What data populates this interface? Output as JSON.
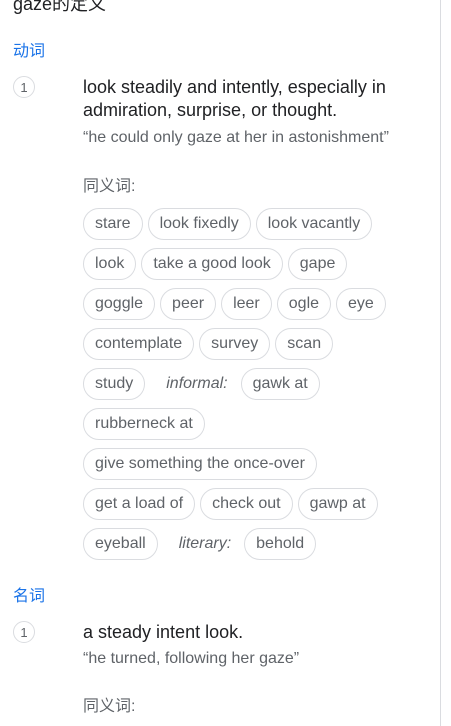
{
  "header": {
    "title": "gaze的定义"
  },
  "verb": {
    "pos_label": "动词",
    "sense_number": "1",
    "definition": "look steadily and intently, especially in admiration, surprise, or thought.",
    "example": "“he could only gaze at her in astonishment”",
    "synonyms_label": "同义词:",
    "rows": [
      [
        {
          "type": "chip",
          "text": "stare"
        },
        {
          "type": "chip",
          "text": "look fixedly"
        },
        {
          "type": "chip",
          "text": "look vacantly"
        }
      ],
      [
        {
          "type": "chip",
          "text": "look"
        },
        {
          "type": "chip",
          "text": "take a good look"
        },
        {
          "type": "chip",
          "text": "gape"
        }
      ],
      [
        {
          "type": "chip",
          "text": "goggle"
        },
        {
          "type": "chip",
          "text": "peer"
        },
        {
          "type": "chip",
          "text": "leer"
        },
        {
          "type": "chip",
          "text": "ogle"
        },
        {
          "type": "chip",
          "text": "eye"
        }
      ],
      [
        {
          "type": "chip",
          "text": "contemplate"
        },
        {
          "type": "chip",
          "text": "survey"
        },
        {
          "type": "chip",
          "text": "scan"
        }
      ],
      [
        {
          "type": "chip",
          "text": "study"
        },
        {
          "type": "register",
          "text": "informal:"
        },
        {
          "type": "chip",
          "text": "gawk at"
        }
      ],
      [
        {
          "type": "chip",
          "text": "rubberneck at"
        }
      ],
      [
        {
          "type": "chip",
          "text": "give something the once-over"
        }
      ],
      [
        {
          "type": "chip",
          "text": "get a load of"
        },
        {
          "type": "chip",
          "text": "check out"
        },
        {
          "type": "chip",
          "text": "gawp at"
        }
      ],
      [
        {
          "type": "chip",
          "text": "eyeball"
        },
        {
          "type": "register",
          "text": "literary:"
        },
        {
          "type": "chip",
          "text": "behold"
        }
      ]
    ]
  },
  "noun": {
    "pos_label": "名词",
    "sense_number": "1",
    "definition": "a steady intent look.",
    "example": "“he turned, following her gaze”",
    "synonyms_label": "同义词:"
  },
  "colors": {
    "pos_blue": "#1a73e8",
    "chip_border": "#dadce0",
    "secondary_text": "#5f6368"
  }
}
